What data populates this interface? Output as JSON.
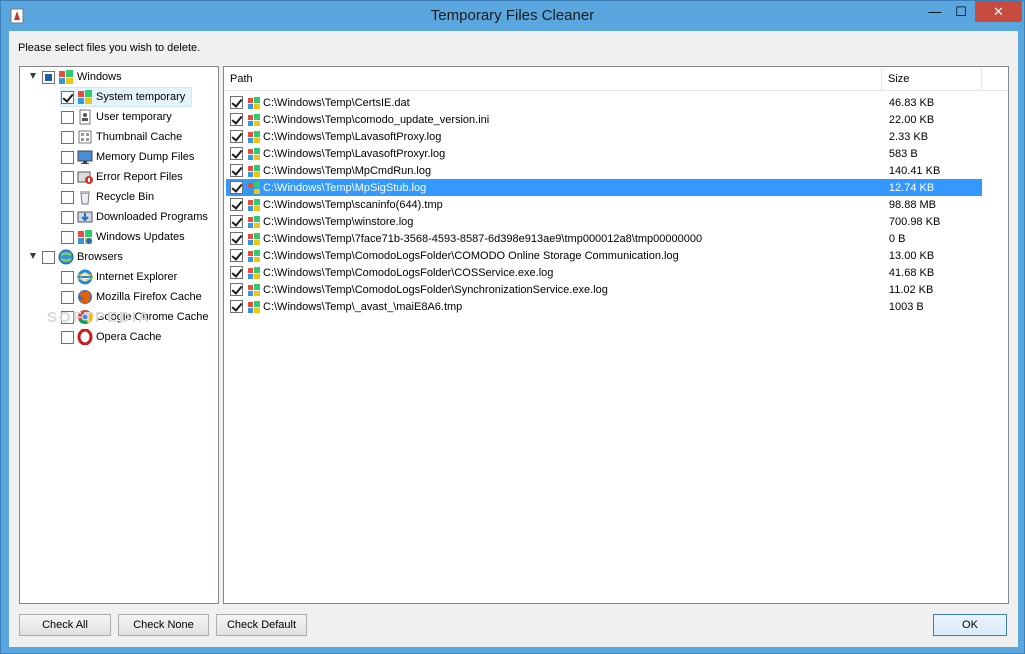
{
  "window": {
    "title": "Temporary Files Cleaner",
    "minimize_glyph": "—",
    "maximize_glyph": "☐",
    "close_glyph": "✕"
  },
  "instruction": "Please select files you wish to delete.",
  "tree": {
    "groups": [
      {
        "label": "Windows",
        "state": "partial",
        "icon": "windows-flag-icon",
        "items": [
          {
            "label": "System temporary",
            "checked": true,
            "selected": true,
            "icon": "windows-flag-icon"
          },
          {
            "label": "User temporary",
            "checked": false,
            "icon": "user-document-icon"
          },
          {
            "label": "Thumbnail Cache",
            "checked": false,
            "icon": "thumbnail-icon"
          },
          {
            "label": "Memory Dump Files",
            "checked": false,
            "icon": "monitor-icon"
          },
          {
            "label": "Error Report Files",
            "checked": false,
            "icon": "error-report-icon"
          },
          {
            "label": "Recycle Bin",
            "checked": false,
            "icon": "recycle-bin-icon"
          },
          {
            "label": "Downloaded Programs",
            "checked": false,
            "icon": "download-icon"
          },
          {
            "label": "Windows Updates",
            "checked": false,
            "icon": "windows-update-icon"
          }
        ]
      },
      {
        "label": "Browsers",
        "state": "unchecked",
        "icon": "globe-icon",
        "items": [
          {
            "label": "Internet Explorer",
            "checked": false,
            "icon": "internet-explorer-icon"
          },
          {
            "label": "Mozilla Firefox Cache",
            "checked": false,
            "icon": "firefox-icon"
          },
          {
            "label": "Google Chrome Cache",
            "checked": false,
            "icon": "chrome-icon"
          },
          {
            "label": "Opera Cache",
            "checked": false,
            "icon": "opera-icon"
          }
        ]
      }
    ]
  },
  "list": {
    "columns": {
      "path": "Path",
      "size": "Size"
    },
    "rows": [
      {
        "path": "C:\\Windows\\Temp\\CertsIE.dat",
        "size": "46.83 KB",
        "checked": true
      },
      {
        "path": "C:\\Windows\\Temp\\comodo_update_version.ini",
        "size": "22.00 KB",
        "checked": true
      },
      {
        "path": "C:\\Windows\\Temp\\LavasoftProxy.log",
        "size": "2.33 KB",
        "checked": true
      },
      {
        "path": "C:\\Windows\\Temp\\LavasoftProxyr.log",
        "size": "583 B",
        "checked": true
      },
      {
        "path": "C:\\Windows\\Temp\\MpCmdRun.log",
        "size": "140.41 KB",
        "checked": true
      },
      {
        "path": "C:\\Windows\\Temp\\MpSigStub.log",
        "size": "12.74 KB",
        "checked": true,
        "selected": true
      },
      {
        "path": "C:\\Windows\\Temp\\scaninfo(644).tmp",
        "size": "98.88 MB",
        "checked": true
      },
      {
        "path": "C:\\Windows\\Temp\\winstore.log",
        "size": "700.98 KB",
        "checked": true
      },
      {
        "path": "C:\\Windows\\Temp\\7face71b-3568-4593-8587-6d398e913ae9\\tmp000012a8\\tmp00000000",
        "size": "0 B",
        "checked": true
      },
      {
        "path": "C:\\Windows\\Temp\\ComodoLogsFolder\\COMODO Online Storage Communication.log",
        "size": "13.00 KB",
        "checked": true
      },
      {
        "path": "C:\\Windows\\Temp\\ComodoLogsFolder\\COSService.exe.log",
        "size": "41.68 KB",
        "checked": true
      },
      {
        "path": "C:\\Windows\\Temp\\ComodoLogsFolder\\SynchronizationService.exe.log",
        "size": "11.02 KB",
        "checked": true
      },
      {
        "path": "C:\\Windows\\Temp\\_avast_\\maiE8A6.tmp",
        "size": "1003 B",
        "checked": true
      }
    ]
  },
  "buttons": {
    "check_all": "Check All",
    "check_none": "Check None",
    "check_default": "Check Default",
    "ok": "OK"
  },
  "watermark": "SOFTPEDIA",
  "colors": {
    "titlebar": "#5aa7df",
    "close_button": "#c74b3e",
    "selection": "#3399ff",
    "tree_hover": "#e5f3fb"
  }
}
